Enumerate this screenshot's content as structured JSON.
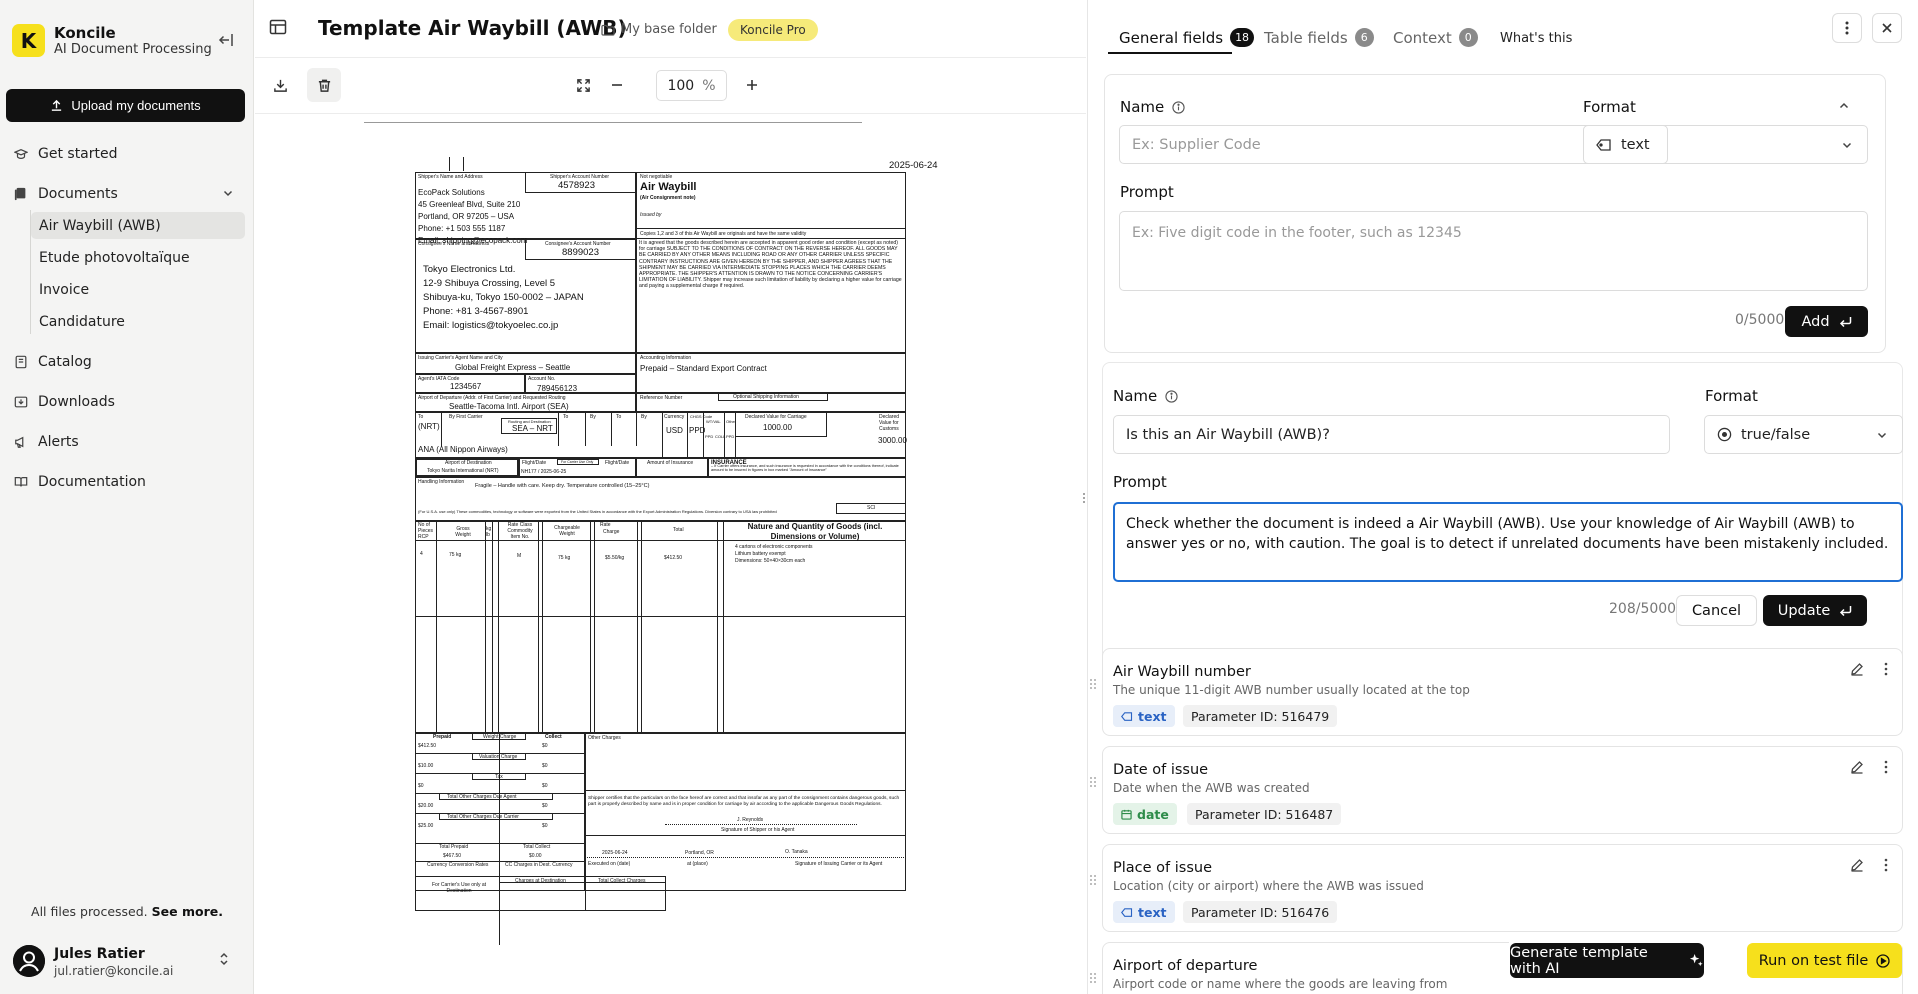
{
  "sidebar": {
    "logo_letter": "K",
    "app_name": "Koncile",
    "app_subtitle": "AI Document Processing",
    "upload_label": "Upload my documents",
    "nav": {
      "get_started": "Get started",
      "documents": "Documents",
      "catalog": "Catalog",
      "downloads": "Downloads",
      "alerts": "Alerts",
      "documentation": "Documentation"
    },
    "documents": [
      "Air Waybill (AWB)",
      "Etude photovoltaïque",
      "Invoice",
      "Candidature"
    ],
    "status_text": "All files processed.",
    "status_link": "See more.",
    "user": {
      "name": "Jules Ratier",
      "email": "jul.ratier@koncile.ai"
    }
  },
  "header": {
    "title": "Template Air Waybill (AWB)",
    "folder": "My base folder",
    "plan_badge": "Koncile Pro"
  },
  "toolbar": {
    "zoom": "100",
    "zoom_unit": "%"
  },
  "awb_doc": {
    "date_top": "2025-06-24",
    "shipper_label": "Shipper's Name and Address",
    "shipper_acct_label": "Shipper's Account Number",
    "shipper_acct": "4578923",
    "shipper_lines": [
      "EcoPack Solutions",
      "45 Greenleaf Blvd, Suite 210",
      "Portland, OR 97205 – USA",
      "Phone: +1 503 555 1187",
      "Email: shipping@ecopack.com"
    ],
    "not_negotiable": "Not negotiable",
    "awb_title": "Air Waybill",
    "awb_sub": "(Air Consignment note)",
    "issued_by": "Issued by",
    "copies_note": "Copies 1,2 and 3 of this Air Waybill are originals and have the same validity",
    "consignee_label": "Consignee's Name and Address",
    "consignee_acct_label": "Consignee's Account Number",
    "consignee_acct": "8899023",
    "consignee_lines": [
      "Tokyo Electronics Ltd.",
      "12-9 Shibuya Crossing, Level 5",
      "Shibuya-ku, Tokyo 150-0002 – JAPAN",
      "Phone: +81 3-4567-8901",
      "Email: logistics@tokyoelec.co.jp"
    ],
    "terms_text": "It is agreed that the goods described herein are accepted in apparent good order and condition (except as noted) for carriage SUBJECT TO THE CONDITIONS OF CONTRACT ON THE REVERSE HEREOF. ALL GOODS MAY BE CARRIED BY ANY OTHER MEANS INCLUDING ROAD OR ANY OTHER CARRIER UNLESS SPECIFIC CONTRARY INSTRUCTIONS ARE GIVEN HEREON BY THE SHIPPER, AND SHIPPER AGREES THAT THE SHIPMENT MAY BE CARRIED VIA INTERMEDIATE STOPPING PLACES WHICH THE CARRIER DEEMS APPROPRIATE. THE SHIPPER'S ATTENTION IS DRAWN TO THE NOTICE CONCERNING CARRIER'S LIMITATION OF LIABILITY. Shipper may increase such limitation of liability by declaring a higher value for carriage and paying a supplemental charge if required.",
    "agent_label": "Issuing Carrier's Agent Name and City",
    "agent": "Global Freight Express – Seattle",
    "accounting_label": "Accounting Information",
    "accounting": "Prepaid – Standard Export Contract",
    "iata_label": "Agent's IATA Code",
    "iata": "1234567",
    "account_no_label": "Account No.",
    "account_no": "789456123",
    "departure_label": "Airport of Departure (Addr. of First Carrier) and Requested Routing",
    "departure": "Seattle-Tacoma Intl. Airport (SEA)",
    "reference_label": "Reference Number",
    "optional_label": "Optional Shipping Information",
    "to_label": "To",
    "to_value": "(NRT)",
    "first_carrier_label": "By First Carrier",
    "routing_label": "Routing and Destination",
    "routing": "SEA – NRT",
    "carrier_name": "ANA (All Nippon Airways)",
    "by_label": "By",
    "currency_label": "Currency",
    "currency": "USD",
    "chgs_label": "CHGS Code",
    "ppd": "PPD",
    "wtval_label": "WT/VAL",
    "other_label": "Other",
    "ppd_label": "PPD",
    "coll_label": "COLL",
    "decl_carriage_label": "Declared Value for Carriage",
    "decl_carriage": "1000.00",
    "decl_customs_label": "Declared Value for Customs",
    "decl_customs": "3000.00",
    "dest_label": "Airport of Destination",
    "dest": "Tokyo Narita International (NRT)",
    "flight_label": "Flight/Date",
    "carrier_use_label": "For Carrier Use Only",
    "flight": "NH177 / 2025-06-25",
    "amount_ins_label": "Amount of Insurance",
    "insurance_label": "INSURANCE",
    "insurance_text": "– If Carrier offers insurance, and such insurance is requested in accordance with the conditions thereof, indicate amount to be insured in figures in box marked \"Amount of Insurance\"",
    "handling_label": "Handling Information",
    "handling": "Fragile – Handle with care. Keep dry. Temperature controlled (15–25°C)",
    "export_note": "(For U.S.A. use only) These commodities, technology or software were exported from the United States in accordance with the Export Administration Regulations. Diversion contrary to USA law prohibited",
    "sci_label": "SCI",
    "col_pieces": "No of Pieces RCP",
    "col_gross": "Gross Weight",
    "col_kg": "kg lb",
    "col_rate_class": "Rate Class",
    "col_commodity": "Commodity Item No.",
    "col_chargeable": "Chargeable Weight",
    "col_rate": "Rate",
    "col_charge": "Charge",
    "col_total": "Total",
    "col_nature": "Nature and Quantity of Goods (incl. Dimensions or Volume)",
    "pieces": "4",
    "gross": "75 kg",
    "rate_class": "M",
    "chargeable": "75 kg",
    "rate": "$5.50/kg",
    "total": "$412.50",
    "goods_lines": [
      "4 cartons of electronic components",
      "Lithium battery exempt",
      "Dimensions: 50×40×30cm each"
    ],
    "prepaid_label": "Prepaid",
    "weight_charge_label": "Weight Charge",
    "collect_label": "Collect",
    "other_charges_label": "Other Charges",
    "val_charge_label": "Valuation Charge",
    "tax_label": "Tax",
    "due_agent_label": "Total Other Charges Due Agent",
    "due_carrier_label": "Total Other Charges Due Carrier",
    "prepaid_values": [
      "$412.50",
      "$10.00",
      "$0",
      "$20.00",
      "$25.00"
    ],
    "collect_values": [
      "$0",
      "$0",
      "$0",
      "$0",
      "$0"
    ],
    "total_prepaid_label": "Total Prepaid",
    "total_collect_label": "Total Collect",
    "total_prepaid": "$467.50",
    "total_collect": "$0.00",
    "conv_label": "Currency Conversion Rates",
    "cc_label": "CC Charges in Dest. Currency",
    "carrier_only_label": "For Carrier's Use only at Destination",
    "charges_dest_label": "Charges at Destination",
    "total_collect_charges_label": "Total Collect Charges",
    "cert_text": "Shipper certifies that the particulars on the face hereof are correct and that insofar as any part of the consignment contains dangerous goods, such part is properly described by name and is in proper condition for carriage by air according to the applicable Dangerous Goods Regulations.",
    "shipper_sig": "J. Reynolds",
    "shipper_sig_label": "Signature of Shipper or his Agent",
    "exec_date": "2025-06-24",
    "exec_place": "Portland, OR",
    "carrier_sig": "O. Tanaka",
    "exec_date_label": "Executed on (date)",
    "exec_place_label": "at (place)",
    "carrier_sig_label": "Signature of Issuing Carrier or its Agent"
  },
  "panel": {
    "tabs": [
      {
        "label": "General fields",
        "count": "18"
      },
      {
        "label": "Table fields",
        "count": "6"
      },
      {
        "label": "Context",
        "count": "0"
      }
    ],
    "whats_this": "What's this",
    "new_field": {
      "name_label": "Name",
      "name_placeholder": "Ex: Supplier Code",
      "format_label": "Format",
      "format_value": "text",
      "prompt_label": "Prompt",
      "prompt_placeholder": "Ex: Five digit code in the footer, such as 12345",
      "counter": "0/5000",
      "add_label": "Add"
    },
    "edit_field": {
      "name_label": "Name",
      "name_value": "Is this an Air Waybill (AWB)?",
      "format_label": "Format",
      "format_value": "true/false",
      "prompt_label": "Prompt",
      "prompt_value": "Check whether the document is indeed a Air Waybill (AWB). Use your knowledge of Air Waybill (AWB) to answer yes or no, with caution. The goal is to detect if unrelated documents have been mistakenly included.",
      "counter": "208/5000",
      "cancel_label": "Cancel",
      "update_label": "Update"
    },
    "fields": [
      {
        "title": "Air Waybill number",
        "desc": "The unique 11-digit AWB number usually located at the top",
        "type": "text",
        "pid": "Parameter ID: 516479"
      },
      {
        "title": "Date of issue",
        "desc": "Date when the AWB was created",
        "type": "date",
        "pid": "Parameter ID: 516487"
      },
      {
        "title": "Place of issue",
        "desc": "Location (city or airport) where the AWB was issued",
        "type": "text",
        "pid": "Parameter ID: 516476"
      },
      {
        "title": "Airport of departure",
        "desc": "Airport code or name where the goods are leaving from"
      }
    ],
    "generate_label": "Generate template with AI",
    "run_label": "Run on test file"
  }
}
